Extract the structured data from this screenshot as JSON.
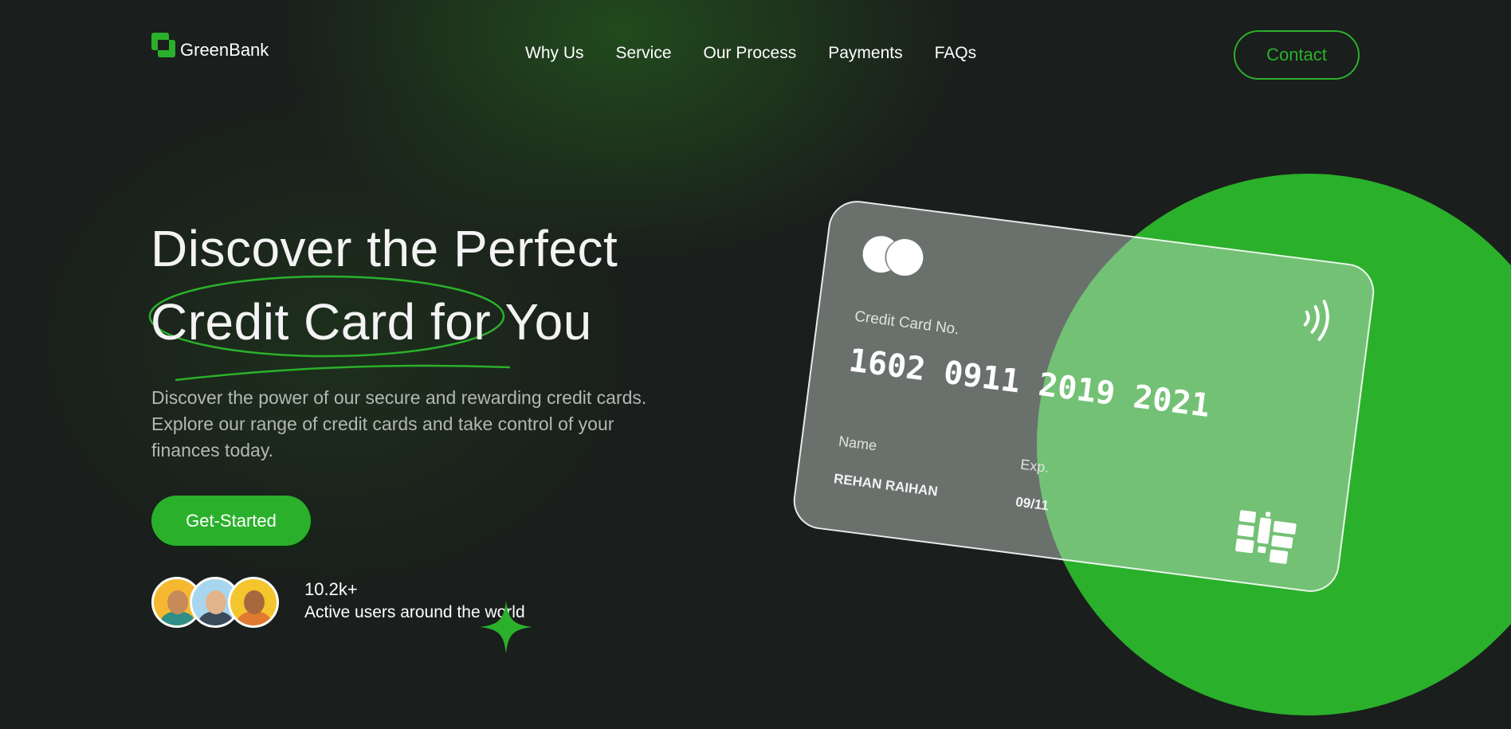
{
  "header": {
    "brand": "GreenBank",
    "nav": [
      "Why Us",
      "Service",
      "Our Process",
      "Payments",
      "FAQs"
    ],
    "contact_label": "Contact"
  },
  "hero": {
    "title_line1": "Discover the Perfect",
    "title_line2": "Credit Card for You",
    "description": "Discover the power of our secure and rewarding credit cards. Explore our range of credit cards and take control of your finances today.",
    "cta_label": "Get-Started",
    "users_count": "10.2k+",
    "users_label": "Active users around the world"
  },
  "card": {
    "number_label": "Credit Card No.",
    "number_groups": [
      "1602",
      "0911",
      "2019",
      "2021"
    ],
    "name_label": "Name",
    "name_value": "REHAN RAIHAN",
    "exp_label": "Exp.",
    "exp_value": "09/11"
  },
  "icons": {
    "logo": "greenbank-logo-icon",
    "card_brand": "mastercard-icon",
    "contactless": "contactless-icon",
    "chip": "chip-icon",
    "sparkle": "sparkle-star-icon"
  },
  "colors": {
    "background": "#1a1e1c",
    "accent": "#2bb02b",
    "text": "#ffffff",
    "muted_text": "#b2b8b3"
  }
}
